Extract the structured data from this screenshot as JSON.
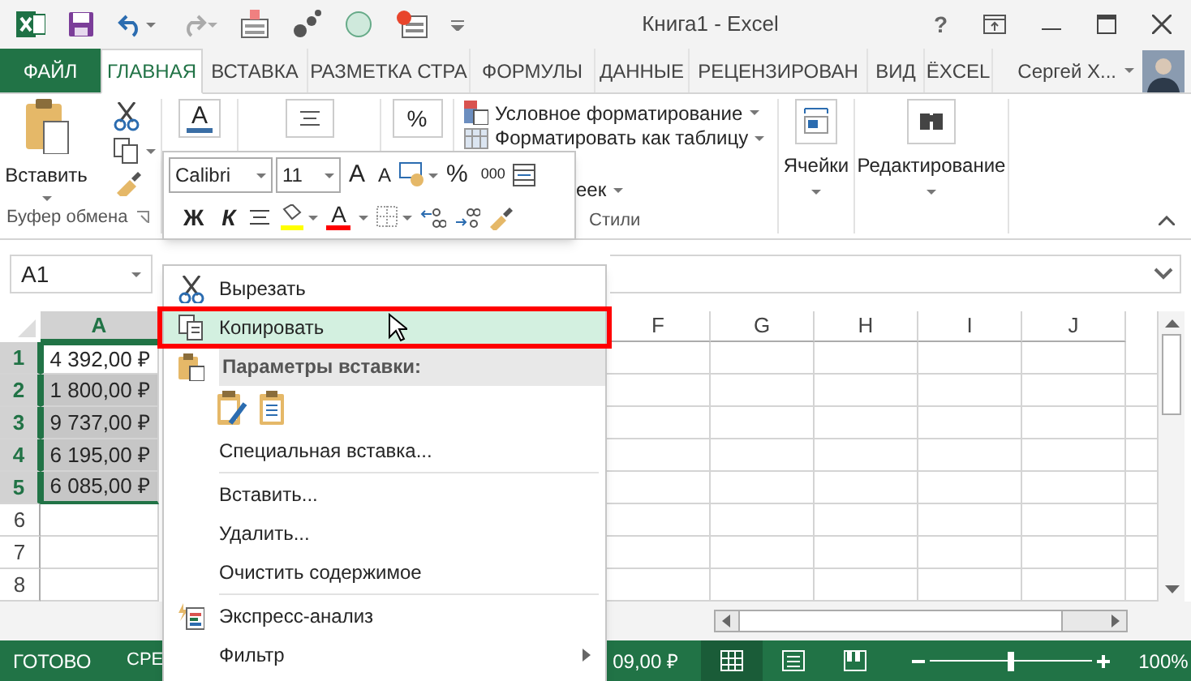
{
  "window": {
    "title": "Книга1 - Excel",
    "help": "?"
  },
  "ribbon_tabs": [
    {
      "label": "ФАЙЛ",
      "kind": "file",
      "selected": false
    },
    {
      "label": "ГЛАВНАЯ",
      "kind": "tab",
      "selected": true
    },
    {
      "label": "ВСТАВКА",
      "kind": "tab",
      "selected": false
    },
    {
      "label": "РАЗМЕТКА СТРА",
      "kind": "tab",
      "selected": false
    },
    {
      "label": "ФОРМУЛЫ",
      "kind": "tab",
      "selected": false
    },
    {
      "label": "ДАННЫЕ",
      "kind": "tab",
      "selected": false
    },
    {
      "label": "РЕЦЕНЗИРОВАН",
      "kind": "tab",
      "selected": false
    },
    {
      "label": "ВИД",
      "kind": "tab",
      "selected": false
    },
    {
      "label": "ЁXCEL",
      "kind": "tab",
      "selected": false
    }
  ],
  "account": {
    "name": "Сергей Х..."
  },
  "ribbon": {
    "clipboard": {
      "paste": "Вставить",
      "label": "Буфер обмена"
    },
    "font_glyph": "A",
    "number_glyph": "%",
    "styles": {
      "items": [
        "Условное форматирование",
        "Форматировать как таблицу",
        "еек"
      ],
      "label": "Стили"
    },
    "cells": "Ячейки",
    "editing": "Редактирование"
  },
  "mini_toolbar": {
    "font": "Calibri",
    "size": "11",
    "grow": "A",
    "shrink": "A",
    "percent": "%",
    "thousands": "000",
    "bold": "Ж",
    "italic": "К",
    "font_color": "A"
  },
  "name_box": "A1",
  "columns": [
    {
      "label": "A",
      "selected": true
    },
    {
      "label": "F",
      "selected": false
    },
    {
      "label": "G",
      "selected": false
    },
    {
      "label": "H",
      "selected": false
    },
    {
      "label": "I",
      "selected": false
    },
    {
      "label": "J",
      "selected": false
    }
  ],
  "rows": [
    {
      "header": "1",
      "selected": true,
      "cells": [
        {
          "value": "4 392,00 ₽",
          "active": true
        }
      ]
    },
    {
      "header": "2",
      "selected": true,
      "cells": [
        {
          "value": "1 800,00 ₽",
          "active": false
        }
      ]
    },
    {
      "header": "3",
      "selected": true,
      "cells": [
        {
          "value": "9 737,00 ₽",
          "active": false
        }
      ]
    },
    {
      "header": "4",
      "selected": true,
      "cells": [
        {
          "value": "6 195,00 ₽",
          "active": false
        }
      ]
    },
    {
      "header": "5",
      "selected": true,
      "cells": [
        {
          "value": "6 085,00 ₽",
          "active": false
        }
      ]
    },
    {
      "header": "6",
      "selected": false,
      "cells": []
    },
    {
      "header": "7",
      "selected": false,
      "cells": []
    },
    {
      "header": "8",
      "selected": false,
      "cells": []
    }
  ],
  "context_menu": [
    {
      "kind": "cut",
      "label": "Вырезать",
      "selected": false
    },
    {
      "kind": "copy",
      "label": "Копировать",
      "selected": true,
      "framed": true
    },
    {
      "kind": "header",
      "label": "Параметры вставки:"
    },
    {
      "kind": "paste_options"
    },
    {
      "kind": "command",
      "label": "Специальная вставка...",
      "selected": false
    },
    {
      "kind": "separator"
    },
    {
      "kind": "command",
      "label": "Вставить...",
      "selected": false
    },
    {
      "kind": "command",
      "label": "Удалить...",
      "selected": false
    },
    {
      "kind": "command",
      "label": "Очистить содержимое",
      "selected": false
    },
    {
      "kind": "separator"
    },
    {
      "kind": "quick_analysis",
      "label": "Экспресс-анализ",
      "selected": false
    },
    {
      "kind": "submenu",
      "label": "Фильтр",
      "selected": false
    }
  ],
  "status_bar": {
    "ready": "ГОТОВО",
    "average": "СРЕ",
    "sum": "09,00 ₽",
    "views": [
      {
        "kind": "normal",
        "selected": true
      },
      {
        "kind": "page_layout",
        "selected": false
      },
      {
        "kind": "page_break",
        "selected": false
      }
    ],
    "zoom": {
      "level": 0.5,
      "reading": "100%"
    }
  }
}
